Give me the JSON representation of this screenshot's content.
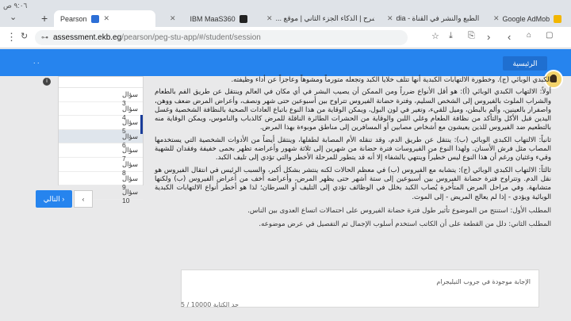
{
  "os": {
    "clock": "٩:٠٦ ص"
  },
  "tabs": [
    {
      "label": "Pearson",
      "fav_color": "#2d6fd6"
    },
    {
      "label": "IBM MaaS360",
      "fav_color": "#222"
    },
    {
      "label": "شرح | الذكاء الجزء الثاني | موقع ...",
      "fav_color": "#e84b3c"
    },
    {
      "label": "حقوق الطبع والنشر في القناة - dia",
      "fav_color": "#e33"
    },
    {
      "label": "Google AdMob",
      "fav_color": "#f2b600"
    }
  ],
  "address": {
    "host": "assessment.ekb.eg",
    "path": "/pearson/peg-stu-app/#/student/session"
  },
  "header": {
    "logout_label": "الرئيسية",
    "dots": ". ."
  },
  "questions": [
    {
      "label": "سؤال 3"
    },
    {
      "label": "سؤال 4"
    },
    {
      "label": "سؤال 5"
    },
    {
      "label": "سؤال 6"
    },
    {
      "label": "سؤال 7"
    },
    {
      "label": "سؤال 8"
    },
    {
      "label": "سؤال 9"
    },
    {
      "label": "سؤال 10"
    }
  ],
  "current_question": "سؤال 6",
  "buttons": {
    "next": "التالي ›",
    "prev": "‹"
  },
  "content": {
    "p1": "الكبدي الوبائي (ج). وخطورة الالتهابات الكبدية أنها تتلف خلايا الكبد وتجعله متورماً ومشوهاً وعاجزاً عن أداء وظيفته.",
    "p2": "أولاً: الالتهاب الكبدي الوبائي (أ): هو أقل الأنواع ضرراً ومن الممكن أن يصيب البشر في أي مكان في العالم وينتقل عن طريق الفم بالطعام والشراب الملوث بالفيروس إلى الشخص السليم، وفترة حضانة الفيروس تتراوح بين أسبوعين حتى شهر ونصف، وأعراض المرض ضعف ووهن، واصفرار بالعينين، وألم بالبطن، وميل للقيء، وتغير في لون البول، ويمكن الوقاية من هذا النوع باتباع العادات الصحية بالنظافة الشخصية وغسل اليدين قبل الأكل والتأكد من نظافة الطعام وغلي اللبن والوقاية من الحشرات الطائرة الناقلة للمرض كالذباب والناموس، ويمكن الوقاية منه بالتطعيم ضد الفيروس للذين يعيشون مع أشخاص مصابين أو المسافرين إلى مناطق موبوءة بهذا المرض.",
    "p3": "ثانياً: الالتهاب الكبدي الوبائي (ب): ينتقل عن طريق الدم، وقد تنقله الأم المصابة لطفلها، وينتقل أيضاً من الأدوات الشخصية التي يستخدمها المصاب مثل فرش الأسنان. ولهذا النوع من الفيروسات فترة حضانة من شهرين إلى ثلاثة شهور وأعراضه تظهر بحمى خفيفة وفقدان للشهية وقيء وغثيان ورغم أن هذا النوع ليس خطيراً وينتهي بالشفاء إلا أنه قد يتطور للمرحلة الأخطر والتي تؤدي إلى تليف الكبد.",
    "p4": "ثالثاً: الالتهاب الكبدي الوبائي (ج): يتشابه مع الفيروس (ب) في معظم الحالات لكنه ينتشر بشكل أكبر، والسبب الرئيس في انتقال الفيروس هو نقل الدم. وتتراوح فترة حضانة الفيروس بين أسبوعين إلى ستة أشهر حتى يظهر المرض، وأعراضه أخف من أعراض الفيروس (ب) ولكنها متشابهة. وفي مراحل المرض المتأخرة يُصاب الكبد بخلل في الوظائف تؤدي إلى التليف أو السرطان؛ لذا هو أخطر أنواع الالتهابات الكبدية الوبائية ويؤدي - إذا لم يعالج المريض - إلى الموت.",
    "q1": "المطلب الأول: استنتج من الموضوع تأثير طول فترة حضانة الفيروس على احتمالات اتساع العدوى بين الناس.",
    "q2": "المطلب الثاني: دلل من القطعة على أن الكاتب استخدم أسلوب الإجمال ثم التفصيل في عرض موضوعه."
  },
  "answer": {
    "placeholder": "الإجابة موجودة في جروب التيليجرام",
    "counter": "5 / 10000 حد الكتابة"
  }
}
